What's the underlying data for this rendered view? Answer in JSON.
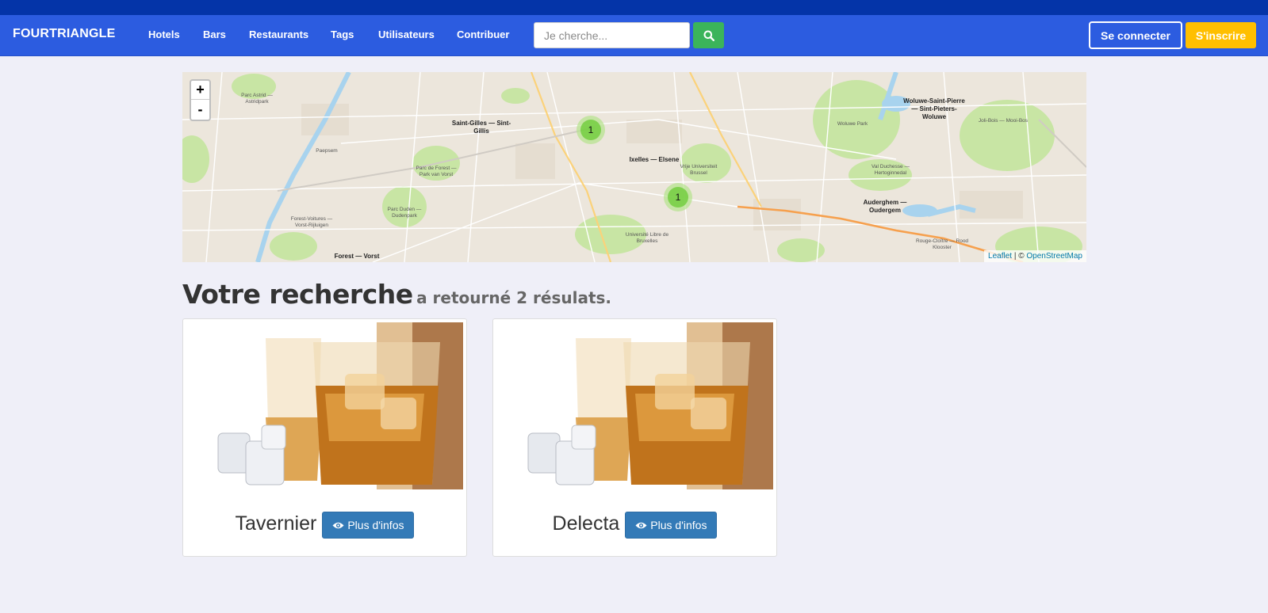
{
  "brand": "FOURTRIANGLE",
  "nav": {
    "items": [
      {
        "label": "Hotels"
      },
      {
        "label": "Bars"
      },
      {
        "label": "Restaurants"
      },
      {
        "label": "Tags"
      },
      {
        "label": "Utilisateurs"
      },
      {
        "label": "Contribuer"
      }
    ]
  },
  "search": {
    "placeholder": "Je cherche...",
    "value": "",
    "icon": "search-icon"
  },
  "auth": {
    "login_label": "Se connecter",
    "signup_label": "S'inscrire"
  },
  "map": {
    "zoom_in": "+",
    "zoom_out": "-",
    "clusters": [
      {
        "count": "1"
      },
      {
        "count": "1"
      }
    ],
    "labels": {
      "saint_gilles": "Saint-Gilles — Sint-Gillis",
      "ixelles": "Ixelles — Elsene",
      "woluwe": "Woluwe-Saint-Pierre — Sint-Pieters-Woluwe",
      "auderghem": "Auderghem — Oudergem",
      "forest": "Forest — Vorst",
      "parc_astrid": "Parc Astrid — Astridpark",
      "paepsem": "Paepsem",
      "parc_forest": "Parc de Forest — Park van Vorst",
      "parc_duden": "Parc Duden — Dudenpark",
      "voitures": "Forest-Voitures — Vorst-Rijluigen",
      "vub": "Vrije Universiteit Brussel",
      "ulb": "Université Libre de Bruxelles",
      "woluwe_park": "Woluwe Park",
      "val_duchesse": "Val Duchesse — Hertoginnedal",
      "joli_bois": "Joli-Bois — Mooi-Bos",
      "rouge_cloitre": "Rouge-Cloître — Rood Klooster"
    },
    "attribution_leaflet": "Leaflet",
    "attribution_sep": " | © ",
    "attribution_osm": "OpenStreetMap",
    "colors": {
      "park": "#c8e5a4",
      "water": "#a8d3ee",
      "road_major": "#f6b26b",
      "base": "#ece6dc"
    }
  },
  "results": {
    "heading": "Votre recherche",
    "subheading": "a retourné 2 résulats.",
    "items": [
      {
        "name": "Tavernier",
        "button_label": "Plus d'infos",
        "icon": "eye-icon"
      },
      {
        "name": "Delecta",
        "button_label": "Plus d'infos",
        "icon": "eye-icon"
      }
    ]
  }
}
